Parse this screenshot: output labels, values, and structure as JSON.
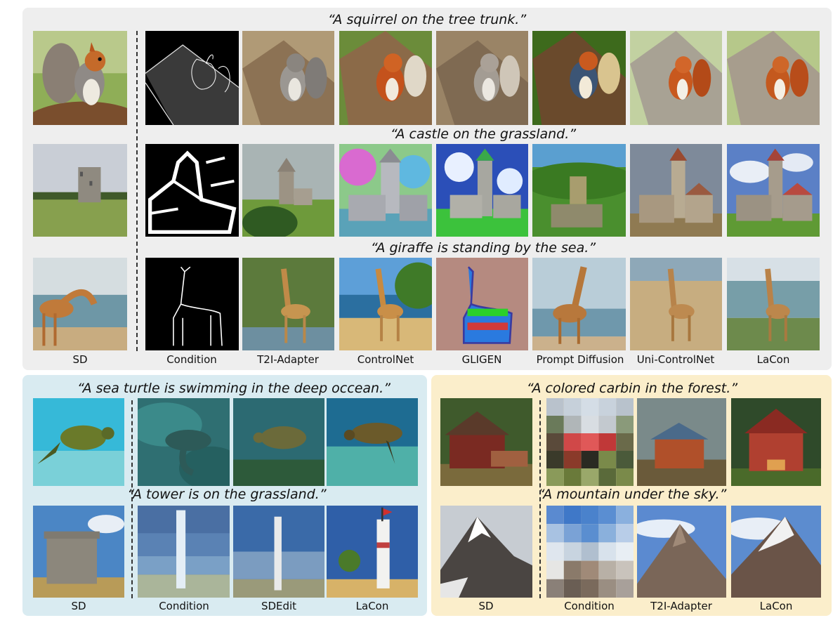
{
  "top_section": {
    "captions": [
      "“A squirrel on the tree trunk.”",
      "“A castle on the grassland.”",
      "“A giraffe is standing by the sea.”"
    ],
    "column_labels": [
      "SD",
      "Condition",
      "T2I-Adapter",
      "ControlNet",
      "GLIGEN",
      "Prompt Diffusion",
      "Uni-ControlNet",
      "LaCon"
    ]
  },
  "bottom_left": {
    "captions": [
      "“A sea turtle is swimming in the deep occean.”",
      "“A tower is on the grassland.”"
    ],
    "column_labels": [
      "SD",
      "Condition",
      "SDEdit",
      "LaCon"
    ]
  },
  "bottom_right": {
    "captions": [
      "“A colored carbin in the forest.”",
      "“A mountain under the sky.”"
    ],
    "column_labels": [
      "SD",
      "Condition",
      "T2I-Adapter",
      "LaCon"
    ]
  },
  "colors": {
    "top_panel": "#eeeeee",
    "bottom_left_panel": "#d9ebf1",
    "bottom_right_panel": "#fbeecb"
  }
}
